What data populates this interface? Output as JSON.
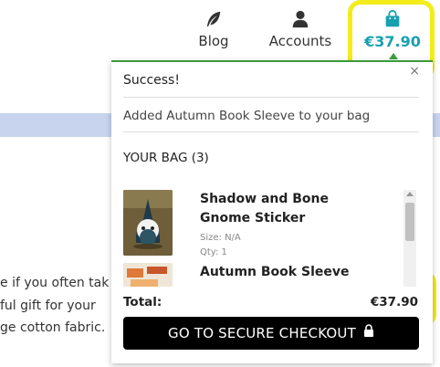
{
  "nav": {
    "blog_label": "Blog",
    "accounts_label": "Accounts",
    "cart_total": "€37.90",
    "accent_color": "#19a0b0"
  },
  "background_text": {
    "line_1": "e if you often tak",
    "line_2": "ful gift for your",
    "line_3": "ge cotton fabric."
  },
  "bag": {
    "close_symbol": "×",
    "success_title": "Success!",
    "added_message": "Added Autumn Book Sleeve to your bag",
    "heading": "YOUR BAG (3)",
    "items": [
      {
        "name": "Shadow and Bone Gnome Sticker",
        "size": "Size: N/A",
        "qty": "Qty: 1"
      },
      {
        "name": "Autumn Book Sleeve"
      }
    ],
    "total_label": "Total:",
    "total_value": "€37.90",
    "checkout_label": "GO TO SECURE CHECKOUT"
  },
  "icons": {
    "blog": "feather-icon",
    "accounts": "user-icon",
    "cart": "shopping-bag-icon",
    "checkout": "lock-icon"
  },
  "colors": {
    "highlight": "#f3ec1a",
    "panel_top_border": "#3a9a3a",
    "checkout_button": "#000000",
    "band": "#c8d4ee"
  }
}
